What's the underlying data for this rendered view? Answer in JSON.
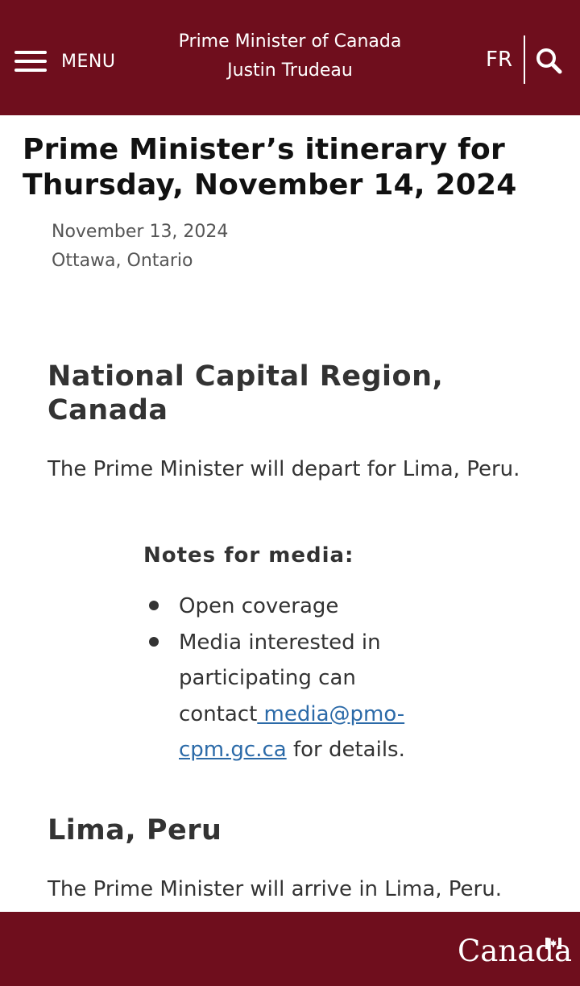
{
  "header": {
    "menu_label": "MENU",
    "site_title_line1": "Prime Minister of Canada",
    "site_title_line2": "Justin Trudeau",
    "language_link": "FR",
    "search_icon": "search-icon",
    "menu_icon": "hamburger-menu-icon"
  },
  "article": {
    "title": "Prime Minister’s itinerary for Thursday, November 14, 2024",
    "date": "November 13, 2024",
    "location": "Ottawa, Ontario",
    "sections": [
      {
        "heading": "National Capital Region, Canada",
        "text": "The Prime Minister will depart for Lima, Peru.",
        "notes_heading": "Notes for media:",
        "notes": [
          "Open coverage",
          "Media interested in participating can contact"
        ],
        "email": " media@pmo-cpm.gc.ca",
        "after_email": " for details."
      },
      {
        "heading": "Lima, Peru",
        "text": "The Prime Minister will arrive in Lima, Peru."
      }
    ]
  },
  "footer": {
    "wordmark": "Canada",
    "flag_icon": "canada-flag-icon"
  },
  "colors": {
    "brand": "#6f0e1d",
    "link": "#2b6aa8",
    "text": "#333333"
  }
}
